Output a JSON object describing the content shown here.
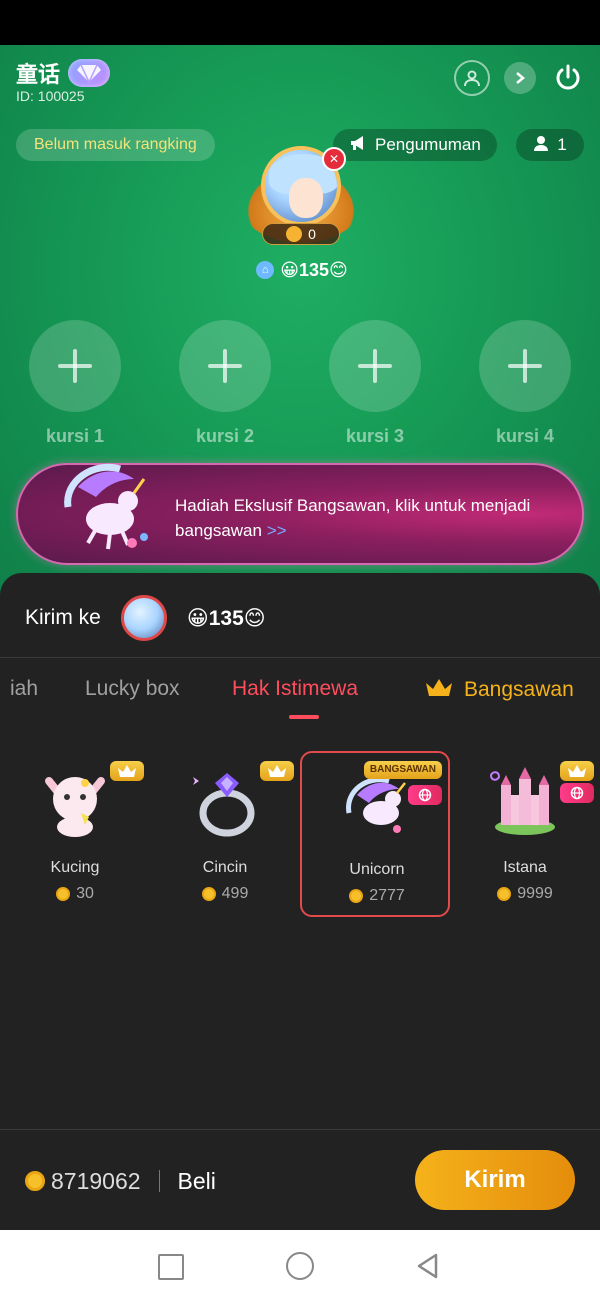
{
  "room": {
    "title": "童话",
    "id_text": "ID: 100025",
    "rank_text": "Belum masuk rangking",
    "announcement_label": "Pengumuman",
    "audience_count": "1",
    "host": {
      "badge_value": "0",
      "name": "😀135😊"
    },
    "seats": [
      {
        "label": "kursi 1"
      },
      {
        "label": "kursi 2"
      },
      {
        "label": "kursi 3"
      },
      {
        "label": "kursi 4"
      }
    ],
    "banner": {
      "text": "Hadiah Ekslusif Bangsawan, klik untuk menjadi bangsawan",
      "link": ">>"
    }
  },
  "gift_sheet": {
    "send_to_label": "Kirim ke",
    "recipient_name": "😀135😊",
    "tabs": [
      {
        "label": "iah"
      },
      {
        "label": "Lucky box"
      },
      {
        "label": "Hak Istimewa",
        "active": true
      },
      {
        "label": "Bangsawan"
      }
    ],
    "gifts": [
      {
        "name": "Kucing",
        "price": "30",
        "tag": "crown"
      },
      {
        "name": "Cincin",
        "price": "499",
        "tag": "crown"
      },
      {
        "name": "Unicorn",
        "price": "2777",
        "tag": "BANGSAWAN",
        "selected": true
      },
      {
        "name": "Istana",
        "price": "9999",
        "tag": "crown"
      }
    ],
    "balance": "8719062",
    "buy_label": "Beli",
    "send_label": "Kirim"
  },
  "colors": {
    "room_green": "#169a55",
    "accent_red": "#ff4d5e",
    "accent_gold": "#f5b21a",
    "sheet_bg": "#222222"
  },
  "icons": [
    "profile-icon",
    "arrow-right-icon",
    "power-icon",
    "megaphone-icon",
    "person-icon",
    "mute-mic-icon",
    "home-icon",
    "plus-icon",
    "crown-icon",
    "globe-icon",
    "coin-icon",
    "nav-recents-icon",
    "nav-home-icon",
    "nav-back-icon"
  ]
}
